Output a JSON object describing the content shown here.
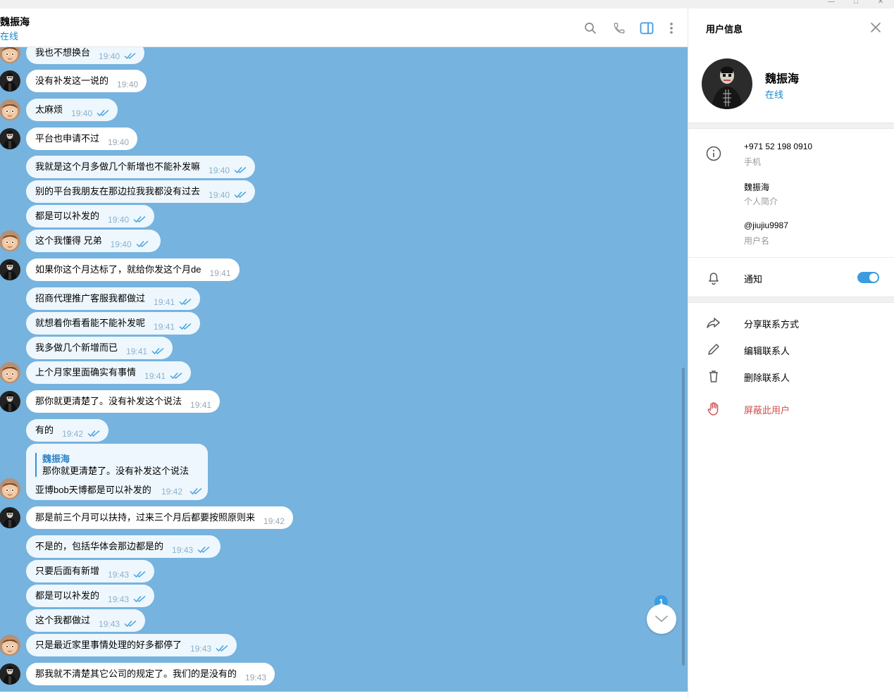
{
  "window": {
    "minimize": "—",
    "maximize": "□",
    "close": "✕"
  },
  "header": {
    "name": "魏振海",
    "status": "在线",
    "icons": [
      "search-icon",
      "phone-icon",
      "sidebar-toggle-icon",
      "more-icon"
    ]
  },
  "messages": [
    {
      "dir": "out",
      "text": "我也不想换台",
      "time": "19:40",
      "avatar": "cartoon",
      "read": true
    },
    {
      "dir": "in",
      "text": "没有补发这一说的",
      "time": "19:40",
      "avatar": "photo"
    },
    {
      "dir": "out",
      "text": "太麻烦",
      "time": "19:40",
      "avatar": "cartoon",
      "read": true
    },
    {
      "dir": "in",
      "text": "平台也申请不过",
      "time": "19:40",
      "avatar": "photo"
    },
    {
      "dir": "out",
      "text": "我就是这个月多做几个新增也不能补发嘛",
      "time": "19:40",
      "avatar": "",
      "read": true
    },
    {
      "dir": "out",
      "text": "别的平台我朋友在那边拉我我都没有过去",
      "time": "19:40",
      "avatar": "",
      "read": true
    },
    {
      "dir": "out",
      "text": "都是可以补发的",
      "time": "19:40",
      "avatar": "",
      "read": true
    },
    {
      "dir": "out",
      "text": "这个我懂得  兄弟",
      "time": "19:40",
      "avatar": "cartoon",
      "read": true
    },
    {
      "dir": "in",
      "text": "如果你这个月达标了，就给你发这个月de",
      "time": "19:41",
      "avatar": "photo"
    },
    {
      "dir": "out",
      "text": "招商代理推广客服我都做过",
      "time": "19:41",
      "avatar": "",
      "read": true
    },
    {
      "dir": "out",
      "text": "就想着你看看能不能补发呢",
      "time": "19:41",
      "avatar": "",
      "read": true
    },
    {
      "dir": "out",
      "text": "我多做几个新增而已",
      "time": "19:41",
      "avatar": "",
      "read": true
    },
    {
      "dir": "out",
      "text": "上个月家里面确实有事情",
      "time": "19:41",
      "avatar": "cartoon",
      "read": true
    },
    {
      "dir": "in",
      "text": "那你就更清楚了。没有补发这个说法",
      "time": "19:41",
      "avatar": "photo"
    },
    {
      "dir": "out",
      "text": "有的",
      "time": "19:42",
      "avatar": "",
      "read": true
    }
  ],
  "reply_message": {
    "quote_name": "魏振海",
    "quote_text": "那你就更清楚了。没有补发这个说法",
    "text": "亚博bob天博都是可以补发的",
    "time": "19:42"
  },
  "messages2": [
    {
      "dir": "in",
      "text": "那是前三个月可以扶持，过来三个月后都要按照原则来",
      "time": "19:42",
      "avatar": "photo"
    },
    {
      "dir": "out",
      "text": "不是的，包括华体会那边都是的",
      "time": "19:43",
      "avatar": "",
      "read": true
    },
    {
      "dir": "out",
      "text": "只要后面有新增",
      "time": "19:43",
      "avatar": "",
      "read": true
    },
    {
      "dir": "out",
      "text": "都是可以补发的",
      "time": "19:43",
      "avatar": "",
      "read": true
    },
    {
      "dir": "out",
      "text": "这个我都做过",
      "time": "19:43",
      "avatar": "",
      "read": true
    },
    {
      "dir": "out",
      "text": "只是最近家里事情处理的好多都停了",
      "time": "19:43",
      "avatar": "cartoon",
      "read": true
    },
    {
      "dir": "in",
      "text": "那我就不清楚其它公司的规定了。我们的是没有的",
      "time": "19:43",
      "avatar": "photo"
    }
  ],
  "unread_count": "1",
  "panel": {
    "title": "用户信息",
    "name": "魏振海",
    "status": "在线",
    "phone": "+971 52 198 0910",
    "phone_label": "手机",
    "bio": "魏振海",
    "bio_label": "个人简介",
    "username": "@jiujiu9987",
    "username_label": "用户名",
    "notifications": "通知",
    "notifications_on": true,
    "actions": [
      {
        "label": "分享联系方式",
        "icon": "share-icon"
      },
      {
        "label": "编辑联系人",
        "icon": "edit-icon"
      },
      {
        "label": "删除联系人",
        "icon": "trash-icon"
      },
      {
        "label": "屏蔽此用户",
        "icon": "block-hand-icon",
        "danger": true
      }
    ]
  },
  "colors": {
    "chat_bg": "#76b3de",
    "accent": "#168acd",
    "danger": "#d14e4e"
  }
}
